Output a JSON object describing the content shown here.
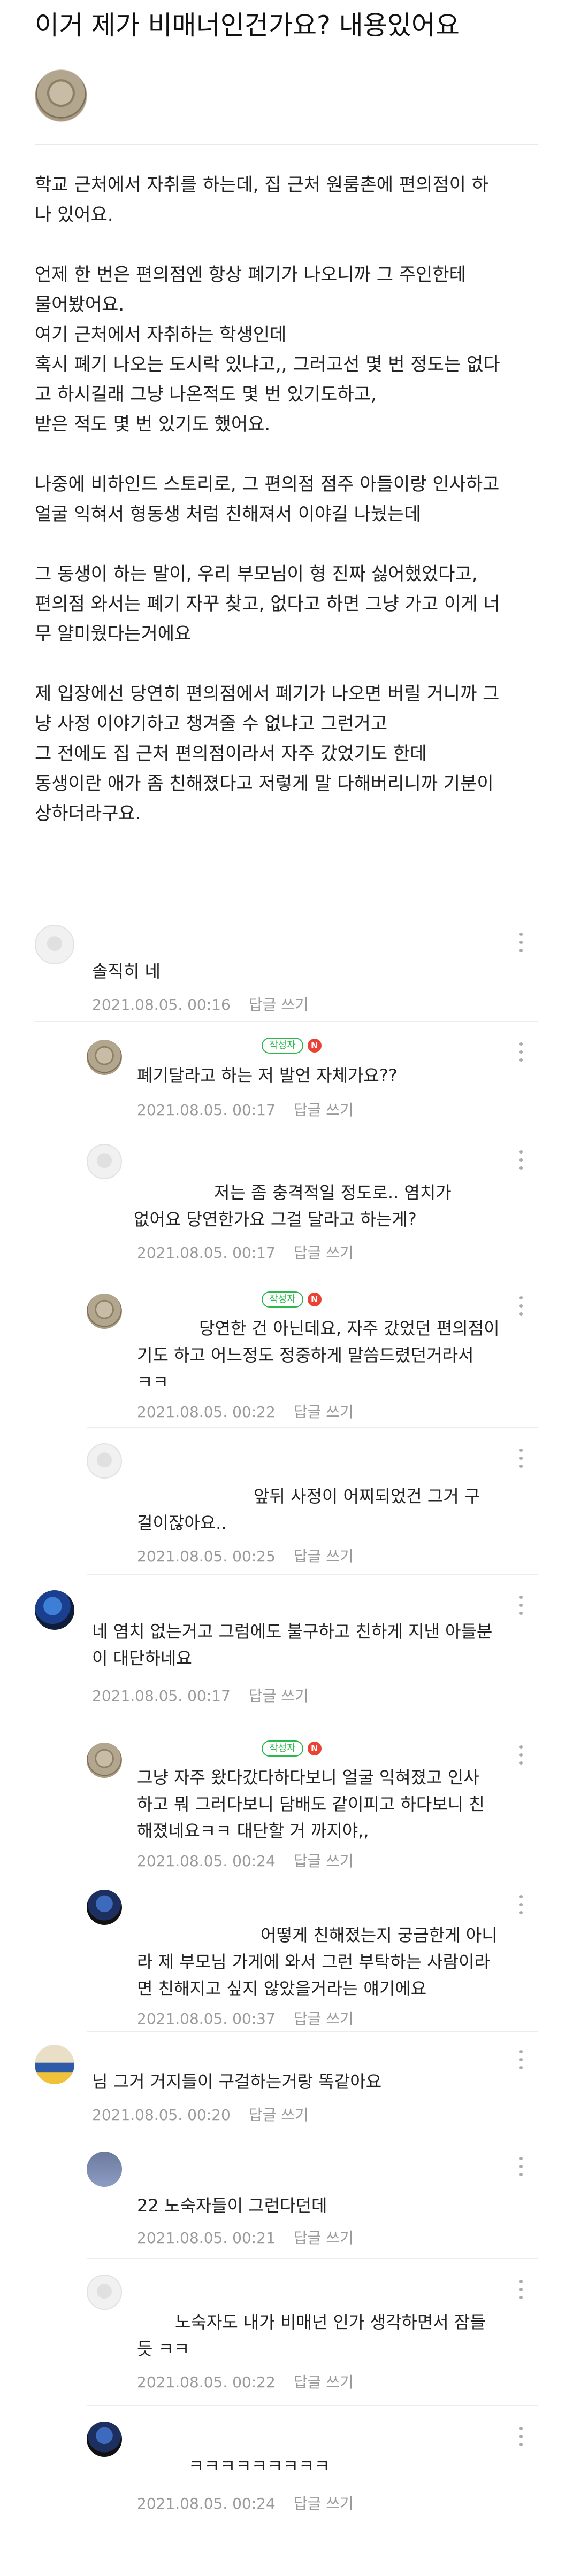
{
  "post": {
    "title": "이거 제가 비매너인건가요? 내용있어요",
    "paragraphs": [
      [
        "학교 근처에서 자취를 하는데, 집 근처 원룸촌에 편의점이 하",
        "나 있어요."
      ],
      [
        "언제 한 번은  편의점엔 항상 폐기가 나오니까 그 주인한테",
        "물어봤어요.",
        "여기 근처에서 자취하는 학생인데",
        "혹시 폐기 나오는 도시락 있냐고,, 그러고선 몇 번 정도는 없다",
        "고 하시길래 그냥 나온적도 몇 번 있기도하고,",
        "받은 적도 몇 번 있기도 했어요."
      ],
      [
        "나중에 비하인드 스토리로, 그 편의점 점주 아들이랑 인사하고",
        "얼굴 익혀서 형동생 처럼 친해져서 이야길 나눴는데"
      ],
      [
        "그 동생이 하는 말이, 우리 부모님이 형 진짜 싫어했었다고,",
        "편의점 와서는 폐기 자꾸 찾고, 없다고 하면 그냥 가고 이게 너",
        "무 얄미웠다는거에요"
      ],
      [
        "제 입장에선 당연히 편의점에서 폐기가 나오면 버릴 거니까 그",
        "냥 사정 이야기하고 챙겨줄 수 없냐고 그런거고",
        "그 전에도 집 근처 편의점이라서 자주 갔었기도 한데",
        "동생이란 애가 좀 친해졌다고 저렇게 말 다해버리니까 기분이",
        "상하더라구요."
      ]
    ]
  },
  "labels": {
    "author_badge": "작성자",
    "new_badge": "N",
    "reply": "답글 쓰기"
  },
  "comments": [
    {
      "lines": [
        "솔직히 네"
      ],
      "date": "2021.08.05. 00:16"
    },
    {
      "lines": [
        "폐기달라고 하는 저 발언 자체가요??"
      ],
      "date": "2021.08.05. 00:17"
    },
    {
      "lines": [
        "저는 좀 충격적일 정도로.. 염치가",
        "없어요 당연한가요 그걸 달라고 하는게?"
      ],
      "date": "2021.08.05. 00:17"
    },
    {
      "lines": [
        "당연한 건 아닌데요, 자주 갔었던 편의점이",
        "기도 하고 어느정도 정중하게 말씀드렸던거라서",
        "ㅋㅋ"
      ],
      "date": "2021.08.05. 00:22"
    },
    {
      "lines": [
        "앞뒤 사정이 어찌되었건 그거 구",
        "걸이잖아요.."
      ],
      "date": "2021.08.05. 00:25"
    },
    {
      "lines": [
        "네 염치 없는거고 그럼에도 불구하고 친하게 지낸 아들분",
        "이 대단하네요"
      ],
      "date": "2021.08.05. 00:17"
    },
    {
      "lines": [
        "그냥 자주 왔다갔다하다보니 얼굴 익혀졌고 인사",
        "하고 뭐 그러다보니 담배도 같이피고 하다보니 친",
        "해졌네요ㅋㅋ 대단할 거 까지야,,"
      ],
      "date": "2021.08.05. 00:24"
    },
    {
      "lines": [
        "어떻게 친해졌는지 궁금한게 아니",
        "라 제 부모님 가게에 와서 그런 부탁하는 사람이라",
        "면 친해지고 싶지 않았을거라는 얘기에요"
      ],
      "date": "2021.08.05. 00:37"
    },
    {
      "lines": [
        "님 그거 거지들이 구걸하는거랑 똑같아요"
      ],
      "date": "2021.08.05. 00:20"
    },
    {
      "lines": [
        "22 노숙자들이 그런다던데"
      ],
      "date": "2021.08.05. 00:21"
    },
    {
      "lines": [
        "노숙자도 내가 비매넌 인가 생각하면서 잠들",
        "듯 ㅋㅋ"
      ],
      "date": "2021.08.05. 00:22"
    },
    {
      "lines": [
        "ㅋㅋㅋㅋㅋㅋㅋㅋㅋ"
      ],
      "date": "2021.08.05. 00:24"
    }
  ]
}
